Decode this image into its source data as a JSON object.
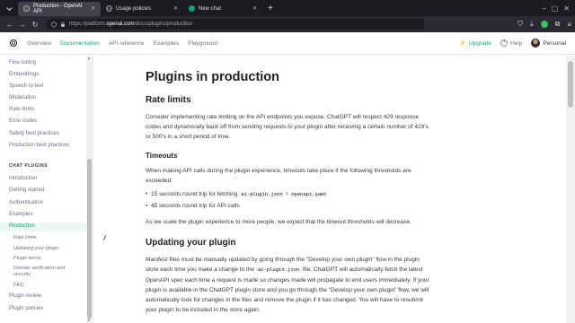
{
  "browser": {
    "tabs": [
      {
        "title": "Production - OpenAI API",
        "active": true
      },
      {
        "title": "Usage policies",
        "active": false
      },
      {
        "title": "New chat",
        "active": false
      }
    ],
    "url_prefix": "https://platform.",
    "url_host": "openai.com",
    "url_path": "/docs/plugins/production"
  },
  "header": {
    "nav": [
      "Overview",
      "Documentation",
      "API reference",
      "Examples",
      "Playground"
    ],
    "active_nav": "Documentation",
    "upgrade": "Upgrade",
    "help": "Help",
    "account": "Personal"
  },
  "sidebar": {
    "top_items": [
      "Fine-tuning",
      "Embeddings",
      "Speech to text",
      "Moderation",
      "Rate limits",
      "Error codes",
      "Safety best practices",
      "Production best practices"
    ],
    "section_title": "CHAT PLUGINS",
    "plugin_items": [
      "Introduction",
      "Getting started",
      "Authentication",
      "Examples",
      "Production"
    ],
    "active_item": "Production",
    "sub_items": [
      "Rate limits",
      "Updating your plugin",
      "Plugin terms",
      "Domain verification and security",
      "FAQ"
    ],
    "bottom_items": [
      "Plugin review",
      "Plugin policies"
    ]
  },
  "content": {
    "title": "Plugins in production",
    "rate_limits": {
      "heading": "Rate limits",
      "paragraph": "Consider implementing rate limiting on the API endpoints you expose. ChatGPT will respect 429 response codes and dynamically back off from sending requests to your plugin after receiving a certain number of 429's or 500's in a short period of time."
    },
    "timeouts": {
      "heading": "Timeouts",
      "intro": "When making API calls during the plugin experience, timeouts take place if the following thresholds are exceeded:",
      "bullet1_text": "15 seconds round trip for fetching",
      "bullet1_code1": "ai-plugin.json",
      "bullet1_sep": "/",
      "bullet1_code2": "openapi.yaml",
      "bullet2": "45 seconds round trip for API calls",
      "outro": "As we scale the plugin experience to more people, we expect that the timeout thresholds will decrease."
    },
    "updating": {
      "heading": "Updating your plugin",
      "p_part1": "Manifest files must be manually updated by going through the \"Develop your own plugin\" flow in the plugin store each time you make a change to the",
      "p_code": "ai-plugin.json",
      "p_part2": "file. ChatGPT will automatically fetch the latest OpenAPI spec each time a request is made so changes made will propagate to end users immediately. If your plugin is available in the ChatGPT plugin store and you go through the \"Develop your own plugin\" flow, we will automatically look for changes in the files and remove the plugin if it has changed. You will have to resubmit your plugin to be included in the store again."
    }
  },
  "colors": {
    "accent": "#10a37f",
    "text": "#353740",
    "heading": "#202123"
  }
}
